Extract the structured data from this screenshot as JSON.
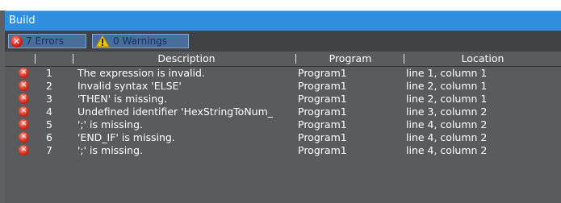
{
  "panel": {
    "title": "Build"
  },
  "filters": {
    "errors_label": "7  Errors",
    "warnings_label": "0  Warnings"
  },
  "columns": {
    "description": "Description",
    "program": "Program",
    "location": "Location"
  },
  "rows": [
    {
      "num": "1",
      "description": "The expression is invalid.",
      "program": "Program1",
      "location": "line 1, column 1"
    },
    {
      "num": "2",
      "description": "Invalid syntax 'ELSE'",
      "program": "Program1",
      "location": "line 2, column 1"
    },
    {
      "num": "3",
      "description": "'THEN' is missing.",
      "program": "Program1",
      "location": "line 2, column 1"
    },
    {
      "num": "4",
      "description": "Undefined identifier 'HexStringToNum_",
      "program": "Program1",
      "location": "line 3, column 2"
    },
    {
      "num": "5",
      "description": "';' is missing.",
      "program": "Program1",
      "location": "line 4, column 2"
    },
    {
      "num": "6",
      "description": "'END_IF' is missing.",
      "program": "Program1",
      "location": "line 4, column 2"
    },
    {
      "num": "7",
      "description": "';' is missing.",
      "program": "Program1",
      "location": "line 4, column 2"
    }
  ],
  "icons": {
    "error": "error-icon",
    "warning": "warning-icon"
  },
  "colors": {
    "title_bar": "#2f8fde",
    "error": "#d11e12",
    "warning": "#f5c400",
    "panel_bg": "#5a5b5c"
  }
}
